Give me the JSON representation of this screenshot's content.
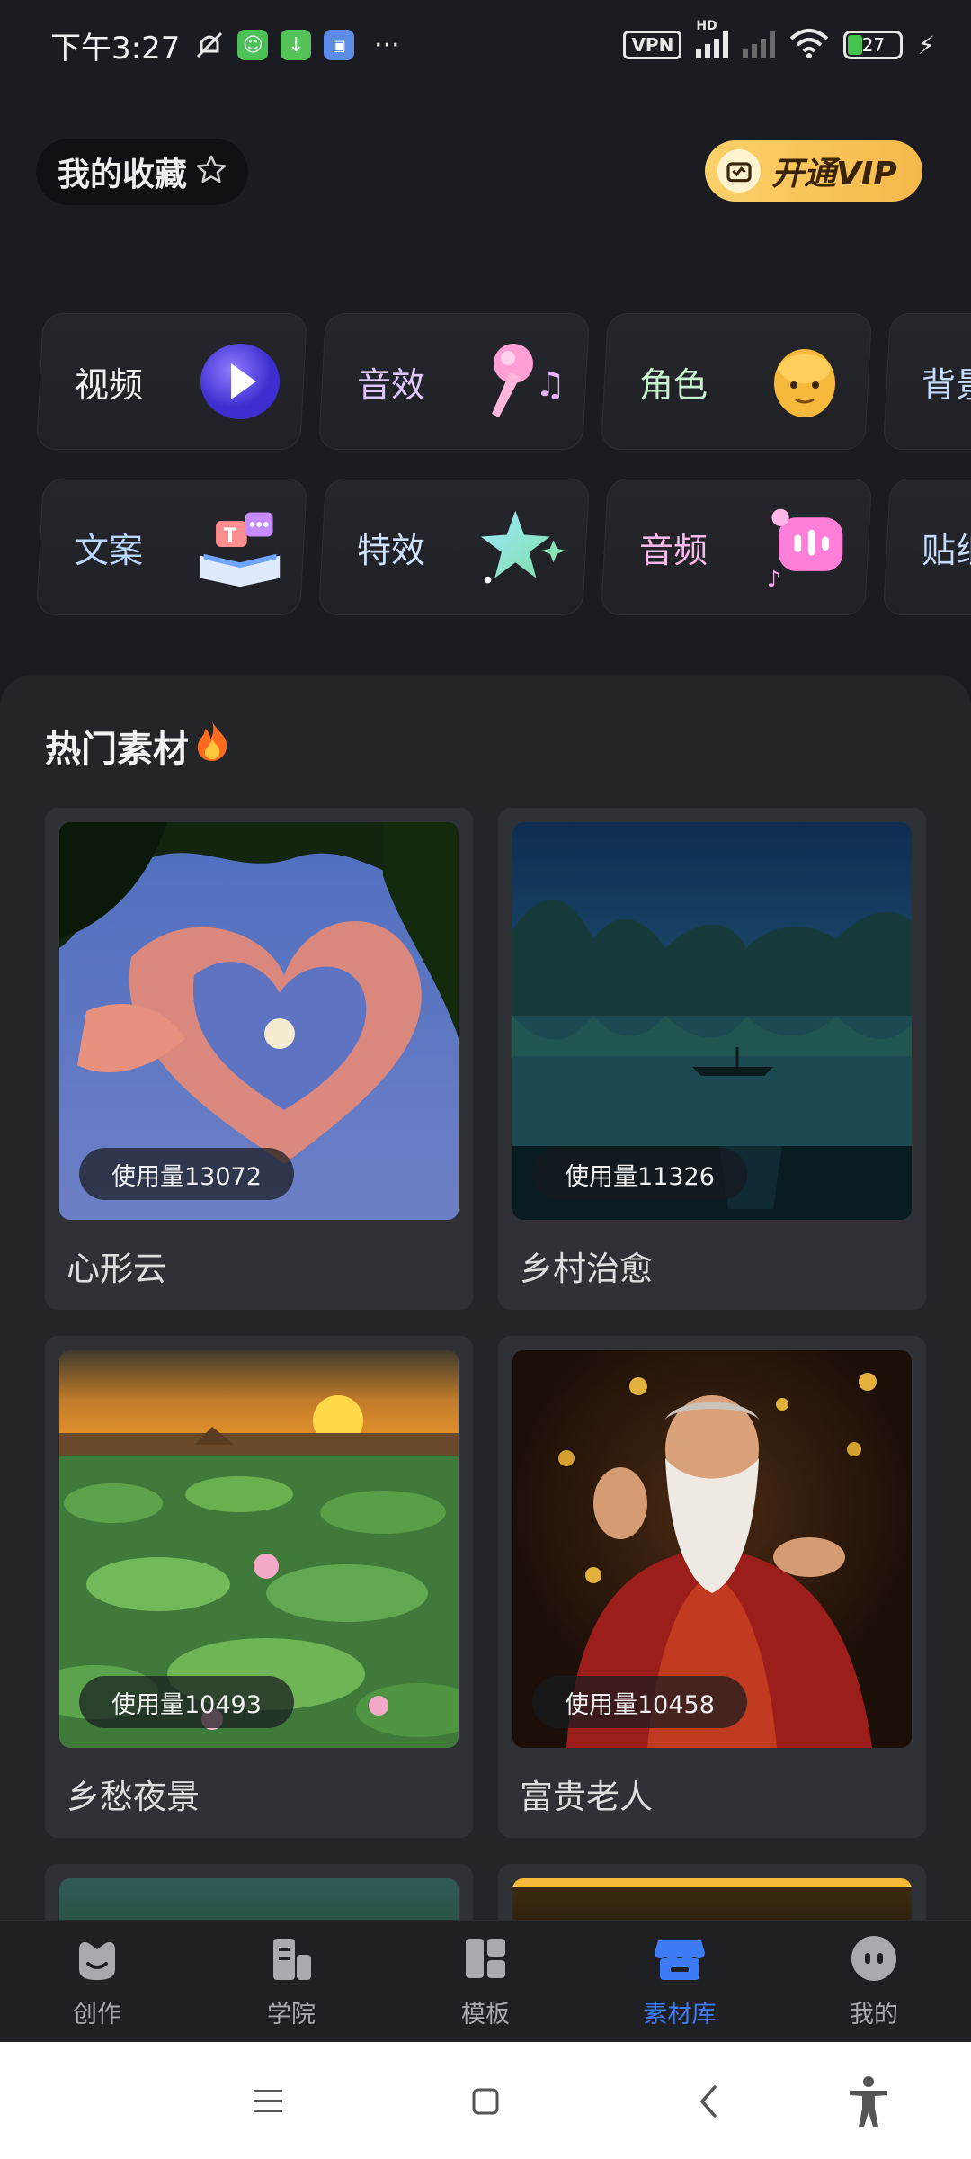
{
  "status_bar": {
    "time": "下午3:27",
    "vpn": "VPN",
    "hd": "HD",
    "battery": "27"
  },
  "header": {
    "favorites_label": "我的收藏",
    "vip_label": "开通VIP"
  },
  "categories": {
    "row1": [
      {
        "label": "视频",
        "icon": "play-icon"
      },
      {
        "label": "音效",
        "icon": "microphone-icon"
      },
      {
        "label": "角色",
        "icon": "face-icon"
      },
      {
        "label": "背景",
        "icon": "background-icon"
      }
    ],
    "row2": [
      {
        "label": "文案",
        "icon": "text-book-icon"
      },
      {
        "label": "特效",
        "icon": "star-icon"
      },
      {
        "label": "音频",
        "icon": "audio-icon"
      },
      {
        "label": "贴纸",
        "icon": "sticker-icon"
      }
    ]
  },
  "hot_section": {
    "title": "热门素材",
    "title_icon": "fire-icon",
    "cards": [
      {
        "title": "心形云",
        "usage": "使用量13072"
      },
      {
        "title": "乡村治愈",
        "usage": "使用量11326"
      },
      {
        "title": "乡愁夜景",
        "usage": "使用量10493"
      },
      {
        "title": "富贵老人",
        "usage": "使用量10458"
      }
    ]
  },
  "bottom_nav": [
    {
      "label": "创作",
      "icon": "create-icon",
      "active": false
    },
    {
      "label": "学院",
      "icon": "academy-icon",
      "active": false
    },
    {
      "label": "模板",
      "icon": "template-icon",
      "active": false
    },
    {
      "label": "素材库",
      "icon": "store-icon",
      "active": true
    },
    {
      "label": "我的",
      "icon": "profile-icon",
      "active": false
    }
  ],
  "colors": {
    "background": "#1b1c21",
    "panel": "#242529",
    "accent": "#3d7cf6",
    "vip_gold": "#f8c44f"
  }
}
